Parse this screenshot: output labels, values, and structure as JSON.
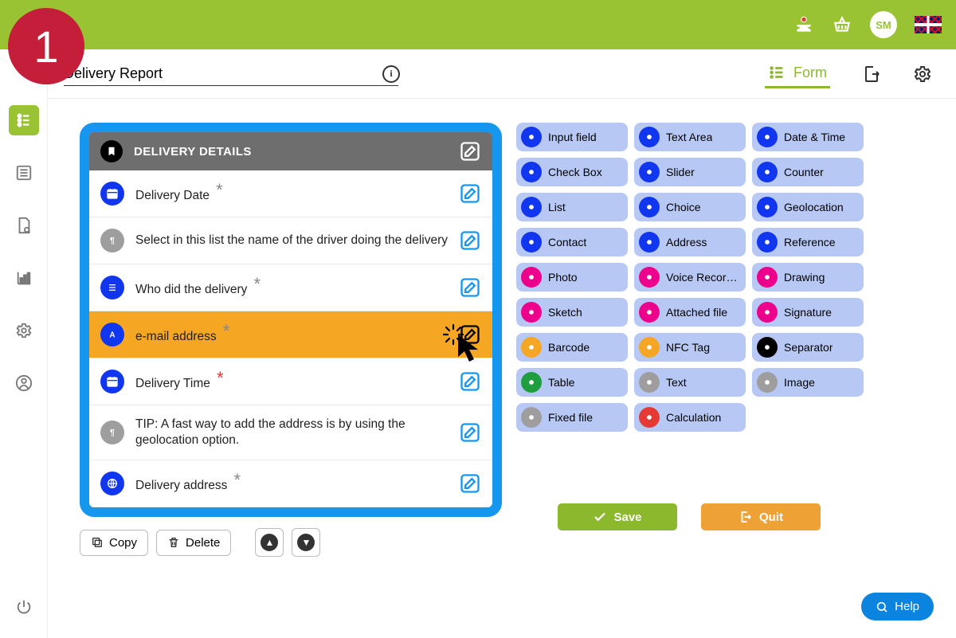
{
  "marker": "1",
  "topbar": {
    "avatar": "SM"
  },
  "subbar": {
    "title": "Delivery Report",
    "form_tab": "Form"
  },
  "canvas": {
    "section_title": "DELIVERY DETAILS",
    "rows": [
      {
        "label": "Delivery Date",
        "required": "*",
        "iconColor": "blue",
        "icon": "calendar"
      },
      {
        "label": "Select in this list the name of the driver doing the delivery",
        "required": "",
        "iconColor": "grey",
        "icon": "para"
      },
      {
        "label": "Who did the delivery",
        "required": "*",
        "iconColor": "blue",
        "icon": "list"
      },
      {
        "label": "e-mail address",
        "required": "*",
        "iconColor": "blue",
        "icon": "A",
        "selected": true
      },
      {
        "label": "Delivery Time",
        "required": "*",
        "requiredRed": true,
        "iconColor": "blue",
        "icon": "calendar"
      },
      {
        "label": "TIP: A fast way to add the address is by using the geolocation option.",
        "required": "",
        "iconColor": "grey",
        "icon": "para"
      },
      {
        "label": "Delivery address",
        "required": "*",
        "iconColor": "blue",
        "icon": "globe"
      }
    ]
  },
  "toolbar": {
    "copy": "Copy",
    "delete": "Delete"
  },
  "palette": [
    {
      "label": "Input field",
      "color": "#1136f0"
    },
    {
      "label": "Text Area",
      "color": "#1136f0"
    },
    {
      "label": "Date & Time",
      "color": "#1136f0"
    },
    {
      "label": "Check Box",
      "color": "#1136f0"
    },
    {
      "label": "Slider",
      "color": "#1136f0"
    },
    {
      "label": "Counter",
      "color": "#1136f0"
    },
    {
      "label": "List",
      "color": "#1136f0"
    },
    {
      "label": "Choice",
      "color": "#1136f0"
    },
    {
      "label": "Geolocation",
      "color": "#1136f0"
    },
    {
      "label": "Contact",
      "color": "#1136f0"
    },
    {
      "label": "Address",
      "color": "#1136f0"
    },
    {
      "label": "Reference",
      "color": "#1136f0"
    },
    {
      "label": "Photo",
      "color": "#ec008c"
    },
    {
      "label": "Voice Recorder",
      "color": "#ec008c"
    },
    {
      "label": "Drawing",
      "color": "#ec008c"
    },
    {
      "label": "Sketch",
      "color": "#ec008c"
    },
    {
      "label": "Attached file",
      "color": "#ec008c"
    },
    {
      "label": "Signature",
      "color": "#ec008c"
    },
    {
      "label": "Barcode",
      "color": "#f5a623"
    },
    {
      "label": "NFC Tag",
      "color": "#f5a623"
    },
    {
      "label": "Separator",
      "color": "#000000"
    },
    {
      "label": "Table",
      "color": "#1e9e3e"
    },
    {
      "label": "Text",
      "color": "#9e9e9e"
    },
    {
      "label": "Image",
      "color": "#9e9e9e"
    },
    {
      "label": "Fixed file",
      "color": "#9e9e9e"
    },
    {
      "label": "Calculation",
      "color": "#e53935"
    }
  ],
  "actions": {
    "save": "Save",
    "quit": "Quit"
  },
  "help": "Help"
}
